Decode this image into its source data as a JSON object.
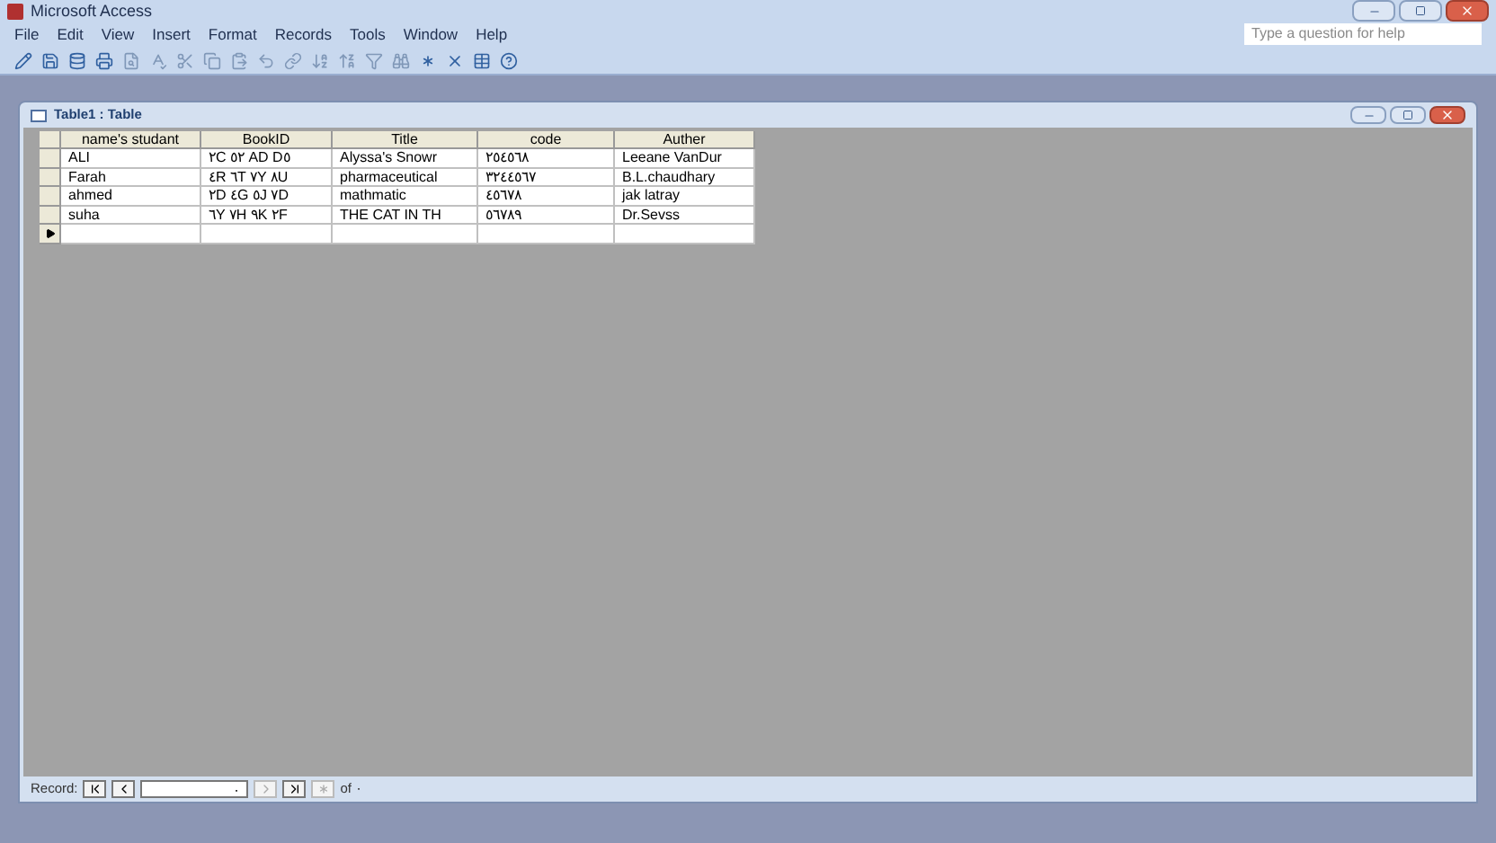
{
  "window": {
    "title": "Microsoft Access"
  },
  "menu": [
    "File",
    "Edit",
    "View",
    "Insert",
    "Format",
    "Records",
    "Tools",
    "Window",
    "Help"
  ],
  "help_box": {
    "placeholder": "Type a question for help"
  },
  "table_window": {
    "title": "Table1 : Table"
  },
  "table": {
    "columns": [
      "name's studant",
      "BookID",
      "Title",
      "code",
      "Auther"
    ],
    "rows": [
      {
        "current": false,
        "cells": [
          "ALI",
          "٢C ٥٢ AD D٥",
          "Alyssa's Snowr",
          "٢٥٤٥٦٨",
          "Leeane VanDur"
        ]
      },
      {
        "current": false,
        "cells": [
          "Farah",
          "٤R ٦T ٧Y ٨U",
          "pharmaceutical",
          "٣٢٤٤٥٦٧",
          "B.L.chaudhary"
        ]
      },
      {
        "current": false,
        "cells": [
          "ahmed",
          "٢D ٤G ٥J ٧D",
          "mathmatic",
          "٤٥٦٧٨",
          "jak latray"
        ]
      },
      {
        "current": false,
        "cells": [
          "suha",
          "٦Y ٧H ٩K ٢F",
          "THE CAT IN TH",
          "٥٦٧٨٩",
          "Dr.Sevss"
        ]
      },
      {
        "current": true,
        "cells": [
          "",
          "",
          "",
          "",
          ""
        ]
      }
    ]
  },
  "record_bar": {
    "label": "Record:",
    "value": "٠",
    "of": "of ٠"
  }
}
